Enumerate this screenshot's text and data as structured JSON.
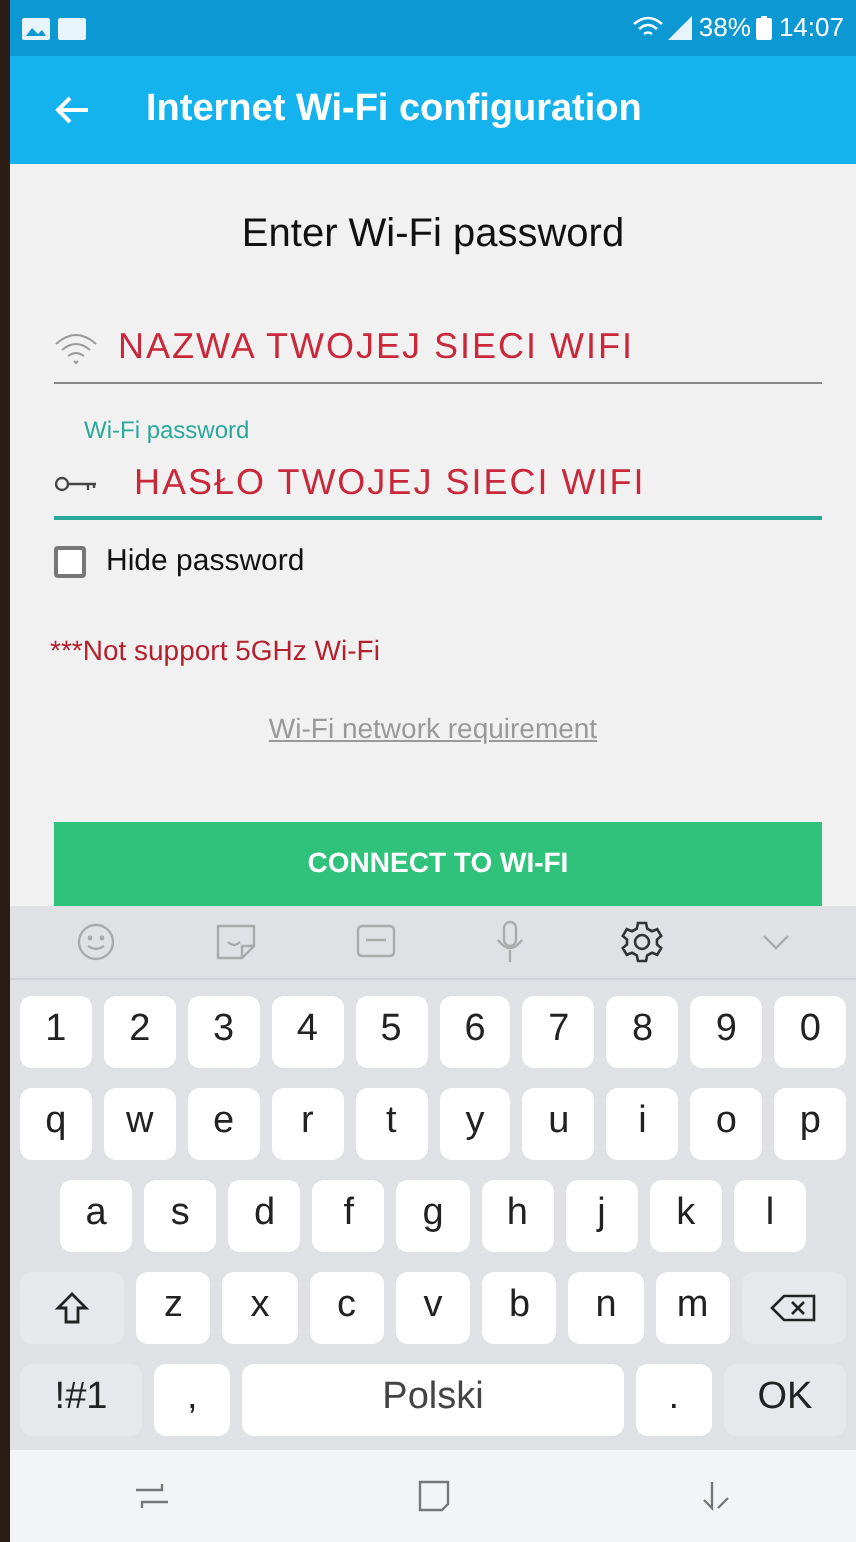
{
  "status_bar": {
    "battery": "38%",
    "time": "14:07"
  },
  "app_bar": {
    "title": "Internet Wi-Fi configuration"
  },
  "heading": "Enter Wi-Fi password",
  "ssid_field": {
    "value": "NAZWA TWOJEJ SIECI WIFI"
  },
  "password_field": {
    "label": "Wi-Fi password",
    "value": "HASŁO TWOJEJ SIECI WIFI"
  },
  "hide_password": {
    "label": "Hide password",
    "checked": false
  },
  "notice": "***Not support 5GHz Wi-Fi",
  "requirement_link": "Wi-Fi network requirement",
  "connect_button": "CONNECT TO WI-FI",
  "keyboard": {
    "rows": [
      [
        {
          "kind": "char",
          "label": "1"
        },
        {
          "kind": "char",
          "label": "2"
        },
        {
          "kind": "char",
          "label": "3"
        },
        {
          "kind": "char",
          "label": "4"
        },
        {
          "kind": "char",
          "label": "5"
        },
        {
          "kind": "char",
          "label": "6"
        },
        {
          "kind": "char",
          "label": "7"
        },
        {
          "kind": "char",
          "label": "8"
        },
        {
          "kind": "char",
          "label": "9"
        },
        {
          "kind": "char",
          "label": "0"
        }
      ],
      [
        {
          "kind": "char",
          "label": "q"
        },
        {
          "kind": "char",
          "label": "w"
        },
        {
          "kind": "char",
          "label": "e"
        },
        {
          "kind": "char",
          "label": "r"
        },
        {
          "kind": "char",
          "label": "t"
        },
        {
          "kind": "char",
          "label": "y"
        },
        {
          "kind": "char",
          "label": "u"
        },
        {
          "kind": "char",
          "label": "i"
        },
        {
          "kind": "char",
          "label": "o"
        },
        {
          "kind": "char",
          "label": "p"
        }
      ],
      [
        {
          "kind": "char",
          "label": "a"
        },
        {
          "kind": "char",
          "label": "s"
        },
        {
          "kind": "char",
          "label": "d"
        },
        {
          "kind": "char",
          "label": "f"
        },
        {
          "kind": "char",
          "label": "g"
        },
        {
          "kind": "char",
          "label": "h"
        },
        {
          "kind": "char",
          "label": "j"
        },
        {
          "kind": "char",
          "label": "k"
        },
        {
          "kind": "char",
          "label": "l"
        }
      ],
      [
        {
          "kind": "shift"
        },
        {
          "kind": "char",
          "label": "z"
        },
        {
          "kind": "char",
          "label": "x"
        },
        {
          "kind": "char",
          "label": "c"
        },
        {
          "kind": "char",
          "label": "v"
        },
        {
          "kind": "char",
          "label": "b"
        },
        {
          "kind": "char",
          "label": "n"
        },
        {
          "kind": "char",
          "label": "m"
        },
        {
          "kind": "backspace"
        }
      ]
    ],
    "bottom_row": {
      "symbols": "!#1",
      "comma": ",",
      "space": "Polski",
      "period": ".",
      "ok": "OK"
    }
  }
}
